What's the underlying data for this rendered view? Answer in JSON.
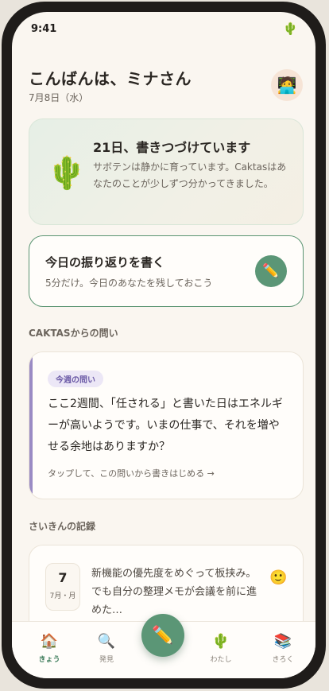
{
  "status_bar": {
    "time": "9:41",
    "icon": "cactus-icon",
    "icon_glyph": "🌵"
  },
  "header": {
    "greeting": "こんばんは、ミナさん",
    "date": "7月8日（水）",
    "avatar_glyph": "🧑‍💻"
  },
  "streak_card": {
    "cactus_glyph": "🌵",
    "title": "21日、書きつづけています",
    "subtitle": "サボテンは静かに育っています。Caktasはあなたのことが少しずつ分かってきました。"
  },
  "write_card": {
    "title": "今日の振り返りを書く",
    "subtitle": "5分だけ。今日のあなたを残しておこう",
    "button_glyph": "✏️"
  },
  "question_section": {
    "title": "CAKTASからの問い",
    "badge": "今週の問い",
    "question": "ここ2週間、「任される」と書いた日はエネルギーが高いようです。いまの仕事で、それを増やせる余地はありますか？",
    "hint": "タップして、この問いから書きはじめる →"
  },
  "records_section": {
    "title": "さいきんの記録",
    "entries": [
      {
        "day": "7",
        "month": "7月・月",
        "text": "新機能の優先度をめぐって板挟み。でも自分の整理メモが会議を前に進めた…",
        "mood_glyph": "🙂"
      }
    ]
  },
  "bottom_nav": {
    "items": [
      {
        "label": "きょう",
        "glyph": "🏠",
        "icon": "home-icon",
        "active": true
      },
      {
        "label": "発見",
        "glyph": "🔍",
        "icon": "search-icon",
        "active": false
      },
      {
        "label": "わたし",
        "glyph": "🌵",
        "icon": "cactus-icon",
        "active": false
      },
      {
        "label": "きろく",
        "glyph": "📚",
        "icon": "books-icon",
        "active": false
      }
    ],
    "fab_glyph": "✏️"
  },
  "colors": {
    "accent": "#5b9676",
    "question_accent": "#9a8bc4",
    "background": "#faf6f0"
  }
}
